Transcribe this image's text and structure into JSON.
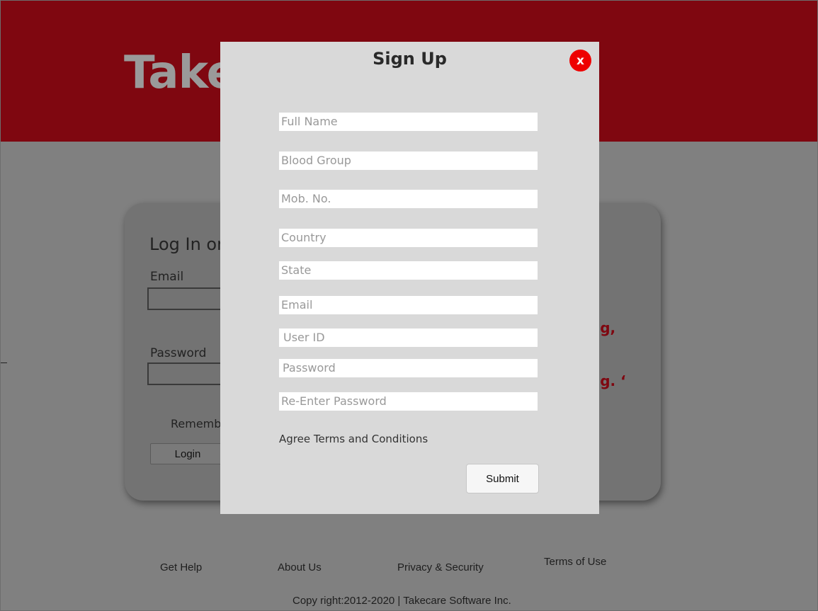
{
  "header": {
    "brand": "Take"
  },
  "login": {
    "title": "Log In or",
    "email_label": "Email",
    "password_label": "Password",
    "remember_label": "Remember",
    "login_button": "Login",
    "side_text_1": "ng,",
    "side_text_2": "ng. ‘"
  },
  "modal": {
    "title": "Sign Up",
    "close_label": "x",
    "fields": {
      "full_name": "Full Name",
      "blood_group": "Blood Group",
      "mobile": "Mob. No.",
      "country": "Country",
      "state": "State",
      "email": "Email",
      "user_id": "User ID",
      "password": "Password",
      "re_password": "Re-Enter Password"
    },
    "agree_label": "Agree Terms and Conditions",
    "submit_label": "Submit"
  },
  "footer": {
    "links": [
      "Get Help",
      "About Us",
      "Privacy & Security",
      "Terms of Use"
    ],
    "copyright": "Copy right:2012-2020 | Takecare Software Inc."
  },
  "colors": {
    "header_bg": "#7f0710",
    "overlay_bg": "#808080",
    "modal_bg": "#d9d9d9",
    "close_button": "#ee0000"
  }
}
